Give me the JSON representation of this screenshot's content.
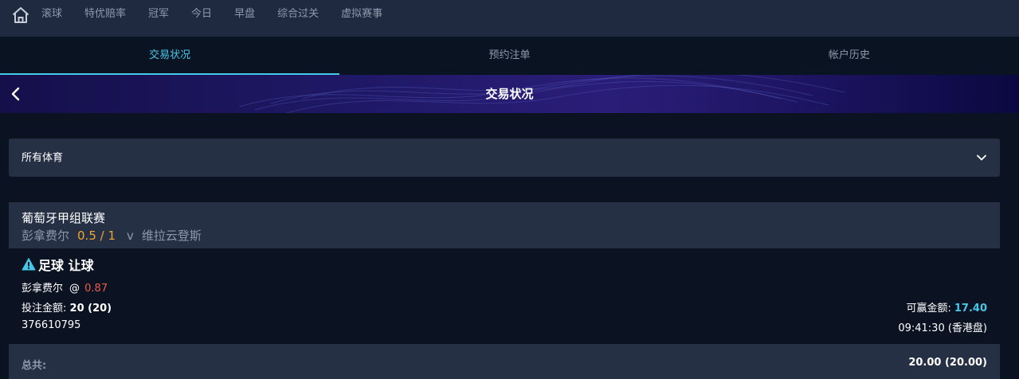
{
  "nav": {
    "home_icon": "home-icon",
    "items": [
      "滚球",
      "特优赔率",
      "冠军",
      "今日",
      "早盘",
      "综合过关",
      "虚拟赛事"
    ]
  },
  "tabs": [
    {
      "label": "交易状况",
      "active": true
    },
    {
      "label": "预约注单",
      "active": false
    },
    {
      "label": "帐户历史",
      "active": false
    }
  ],
  "banner": {
    "title": "交易状况",
    "back_icon": "chevron-left-icon"
  },
  "filter": {
    "selected": "所有体育",
    "icon": "chevron-down-icon"
  },
  "bet": {
    "league": "葡萄牙甲组联赛",
    "home_team": "彭拿费尔",
    "handicap": "0.5 / 1",
    "vs": "v",
    "away_team": "维拉云登斯",
    "bet_type": "足球 让球",
    "selection": "彭拿费尔",
    "at": "@",
    "odds": "0.87",
    "stake_label": "投注金额:",
    "stake_value": "20 (20)",
    "win_label": "可赢金额:",
    "win_value": "17.40",
    "ticket_id": "376610795",
    "time": "09:41:30 (香港盘)"
  },
  "total": {
    "label": "总共:",
    "value": "20.00 (20.00)"
  },
  "colors": {
    "accent": "#46c8e8",
    "odds": "#ee5b4d",
    "handicap": "#f0a52c",
    "panel": "#263045",
    "background": "#0b1221"
  }
}
